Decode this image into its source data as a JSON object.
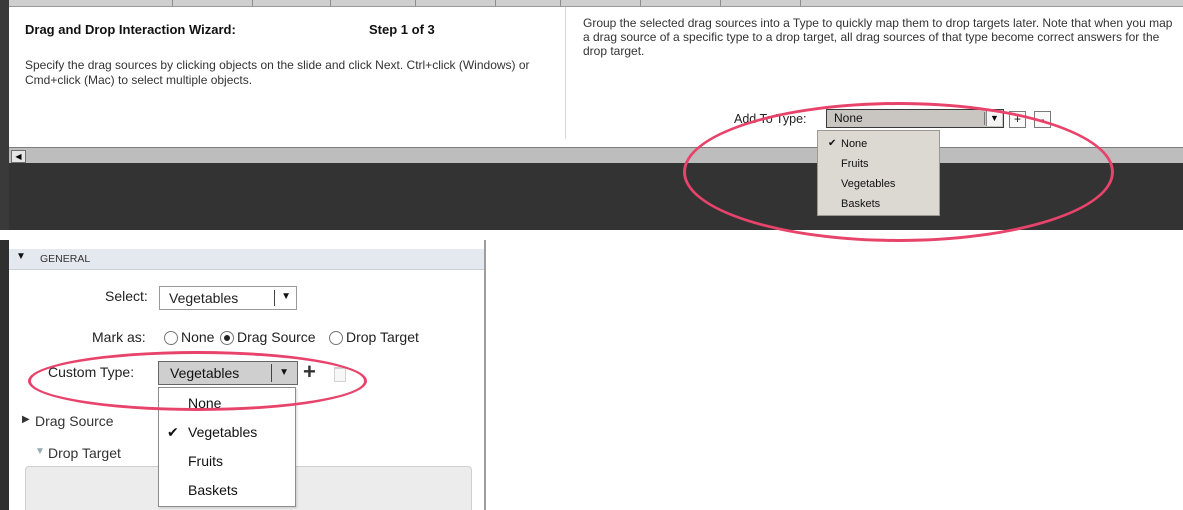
{
  "wizard": {
    "title": "Drag and Drop Interaction Wizard:",
    "step": "Step 1 of 3",
    "instructions": "Specify the drag sources by clicking objects on the slide and click Next. Ctrl+click (Windows) or Cmd+click (Mac) to select multiple objects.",
    "group_help": "Group the selected drag sources into a Type to quickly map them to drop targets later. Note that when you map a drag source of a specific type to a drop target, all drag sources of that type become correct answers for the drop target.",
    "add_to_type_label": "Add To Type:",
    "add_to_type_value": "None",
    "add_button": "+",
    "remove_button": "-",
    "dropdown_options": [
      {
        "label": "None",
        "checked": true
      },
      {
        "label": "Fruits",
        "checked": false
      },
      {
        "label": "Vegetables",
        "checked": false
      },
      {
        "label": "Baskets",
        "checked": false
      }
    ],
    "checkmark": "✔"
  },
  "properties": {
    "section_title": "GENERAL",
    "select_label": "Select:",
    "select_value": "Vegetables",
    "mark_as_label": "Mark as:",
    "mark_options": [
      {
        "label": "None",
        "selected": false
      },
      {
        "label": "Drag Source",
        "selected": true
      },
      {
        "label": "Drop Target",
        "selected": false
      }
    ],
    "custom_type_label": "Custom Type:",
    "custom_type_value": "Vegetables",
    "dropdown_options": [
      {
        "label": "None",
        "checked": false
      },
      {
        "label": "Vegetables",
        "checked": true
      },
      {
        "label": "Fruits",
        "checked": false
      },
      {
        "label": "Baskets",
        "checked": false
      }
    ],
    "checkmark": "✔",
    "drag_source_section": "Drag Source",
    "drop_target_section": "Drop Target"
  },
  "colors": {
    "annotation": "#e8436b",
    "wizard_menu_bg": "#dcd8d2",
    "wizard_dark_bg": "#333333"
  }
}
